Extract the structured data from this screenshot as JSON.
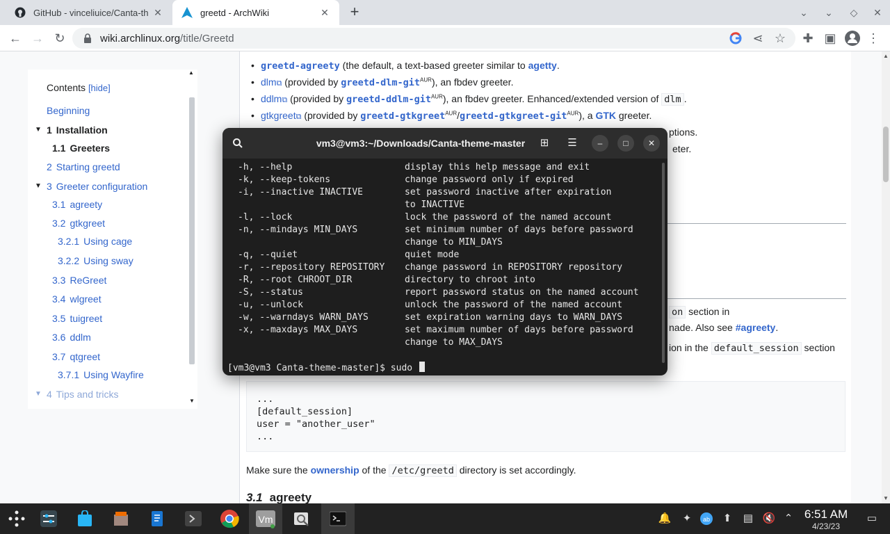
{
  "browser": {
    "tabs": [
      {
        "title": "GitHub - vinceliuice/Canta-th",
        "icon": "github-icon"
      },
      {
        "title": "greetd - ArchWiki",
        "icon": "archlinux-icon"
      }
    ],
    "url_domain": "wiki.archlinux.org",
    "url_path": "/title/Greetd"
  },
  "toc": {
    "title": "Contents",
    "hide": "[hide]",
    "items": [
      {
        "num": "",
        "label": "Beginning"
      },
      {
        "num": "1",
        "label": "Installation"
      },
      {
        "num": "1.1",
        "label": "Greeters"
      },
      {
        "num": "2",
        "label": "Starting greetd"
      },
      {
        "num": "3",
        "label": "Greeter configuration"
      },
      {
        "num": "3.1",
        "label": "agreety"
      },
      {
        "num": "3.2",
        "label": "gtkgreet"
      },
      {
        "num": "3.2.1",
        "label": "Using cage"
      },
      {
        "num": "3.2.2",
        "label": "Using sway"
      },
      {
        "num": "3.3",
        "label": "ReGreet"
      },
      {
        "num": "3.4",
        "label": "wlgreet"
      },
      {
        "num": "3.5",
        "label": "tuigreet"
      },
      {
        "num": "3.6",
        "label": "ddlm"
      },
      {
        "num": "3.7",
        "label": "qtgreet"
      },
      {
        "num": "3.7.1",
        "label": "Using Wayfire"
      },
      {
        "num": "4",
        "label": "Tips and tricks"
      }
    ]
  },
  "article": {
    "b1_link": "greetd-agreety",
    "b1_text": " (the default, a text-based greeter similar to ",
    "b1_link2": "agetty",
    "b1_end": ".",
    "b2_link": "dlm",
    "b2_text": " (provided by ",
    "b2_link2": "greetd-dlm-git",
    "b2_sup": "AUR",
    "b2_end": "), an fbdev greeter.",
    "b3_link": "ddlm",
    "b3_text": " (provided by ",
    "b3_link2": "greetd-ddlm-git",
    "b3_sup": "AUR",
    "b3_mid": "), an fbdev greeter. Enhanced/extended version of ",
    "b3_code": "dlm",
    "b3_end": ".",
    "b4_link": "gtkgreet",
    "b4_text": " (provided by ",
    "b4_link2": "greetd-gtkgreet",
    "b4_sup": "AUR",
    "b4_sep": "/",
    "b4_link3": "greetd-gtkgreet-git",
    "b4_sup2": "AUR",
    "b4_mid": "), a ",
    "b4_link4": "GTK",
    "b4_end": " greeter.",
    "frag_options": "ptions.",
    "frag_eter": "eter.",
    "frag1_code": "on",
    "frag1_text": " section in",
    "frag2_text": "nade. Also see ",
    "frag2_link": "#agreety",
    "frag2_end": ".",
    "frag3_text": "ion in the ",
    "frag3_code": "default_session",
    "frag3_end": " section",
    "pre_block": "...\n[default_session]\nuser = \"another_user\"\n...",
    "own_pre": "Make sure the ",
    "own_link": "ownership",
    "own_mid": " of the ",
    "own_code": "/etc/greetd",
    "own_end": " directory is set accordingly.",
    "h3_num": "3.1",
    "h3_title": "agreety"
  },
  "terminal": {
    "title": "vm3@vm3:~/Downloads/Canta-theme-master",
    "lines": [
      {
        "opt": "-h, --help",
        "desc": "display this help message and exit"
      },
      {
        "opt": "-k, --keep-tokens",
        "desc": "change password only if expired"
      },
      {
        "opt": "-i, --inactive INACTIVE",
        "desc": "set password inactive after expiration"
      },
      {
        "opt": "",
        "desc": "to INACTIVE"
      },
      {
        "opt": "-l, --lock",
        "desc": "lock the password of the named account"
      },
      {
        "opt": "-n, --mindays MIN_DAYS",
        "desc": "set minimum number of days before password"
      },
      {
        "opt": "",
        "desc": "change to MIN_DAYS"
      },
      {
        "opt": "-q, --quiet",
        "desc": "quiet mode"
      },
      {
        "opt": "-r, --repository REPOSITORY",
        "desc": "change password in REPOSITORY repository"
      },
      {
        "opt": "-R, --root CHROOT_DIR",
        "desc": "directory to chroot into"
      },
      {
        "opt": "-S, --status",
        "desc": "report password status on the named account"
      },
      {
        "opt": "-u, --unlock",
        "desc": "unlock the password of the named account"
      },
      {
        "opt": "-w, --warndays WARN_DAYS",
        "desc": "set expiration warning days to WARN_DAYS"
      },
      {
        "opt": "-x, --maxdays MAX_DAYS",
        "desc": "set maximum number of days before password"
      },
      {
        "opt": "",
        "desc": "change to MAX_DAYS"
      }
    ],
    "prompt": "[vm3@vm3 Canta-theme-master]$ sudo "
  },
  "taskbar": {
    "apps": [
      "app-launcher",
      "system-settings",
      "store",
      "file-manager",
      "text-editor",
      "terminal-launcher",
      "chrome",
      "vmware",
      "image-viewer",
      "terminal"
    ],
    "time": "6:51 AM",
    "date": "4/23/23"
  },
  "colors": {
    "link": "#3366cc",
    "terminal_bg": "#1e1e1e",
    "taskbar_bg": "#222222"
  }
}
